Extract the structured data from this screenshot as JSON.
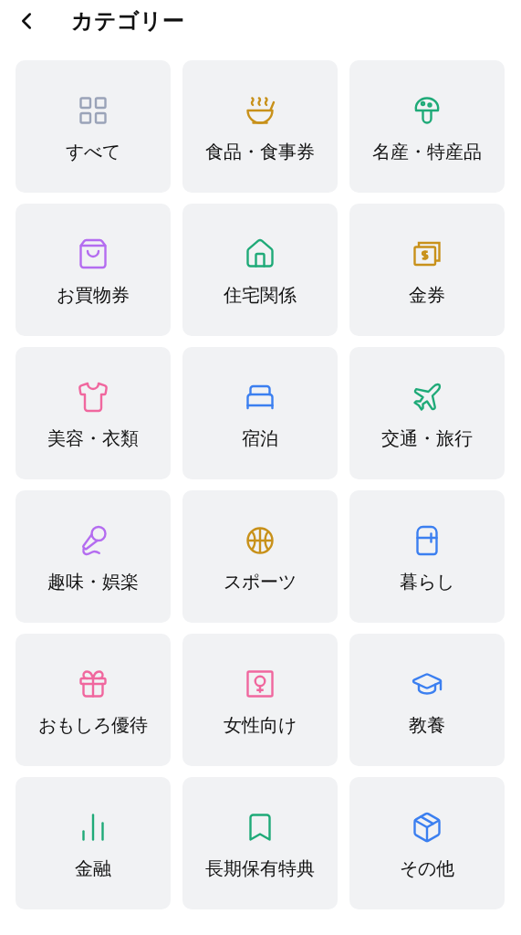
{
  "header": {
    "title": "カテゴリー"
  },
  "categories": [
    {
      "label": "すべて",
      "color": "#9aa3b8"
    },
    {
      "label": "食品・食事券",
      "color": "#c8911a"
    },
    {
      "label": "名産・特産品",
      "color": "#1faa78"
    },
    {
      "label": "お買物券",
      "color": "#b46cf0"
    },
    {
      "label": "住宅関係",
      "color": "#1faa78"
    },
    {
      "label": "金券",
      "color": "#c8911a"
    },
    {
      "label": "美容・衣類",
      "color": "#f0679e"
    },
    {
      "label": "宿泊",
      "color": "#3b7ff0"
    },
    {
      "label": "交通・旅行",
      "color": "#1faa78"
    },
    {
      "label": "趣味・娯楽",
      "color": "#b46cf0"
    },
    {
      "label": "スポーツ",
      "color": "#c8911a"
    },
    {
      "label": "暮らし",
      "color": "#3b7ff0"
    },
    {
      "label": "おもしろ優待",
      "color": "#f0679e"
    },
    {
      "label": "女性向け",
      "color": "#f0679e"
    },
    {
      "label": "教養",
      "color": "#3b7ff0"
    },
    {
      "label": "金融",
      "color": "#1faa78"
    },
    {
      "label": "長期保有特典",
      "color": "#1faa78"
    },
    {
      "label": "その他",
      "color": "#3b7ff0"
    }
  ]
}
